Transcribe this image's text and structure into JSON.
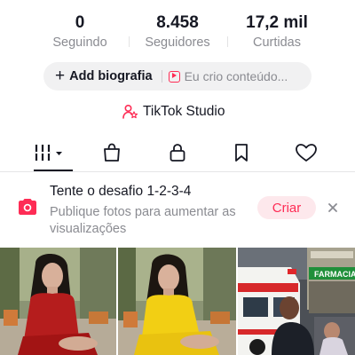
{
  "profile": {
    "stats": [
      {
        "value": "0",
        "label": "Seguindo"
      },
      {
        "value": "8.458",
        "label": "Seguidores"
      },
      {
        "value": "17,2 mil",
        "label": "Curtidas"
      }
    ],
    "add_bio_label": "Add biografia",
    "creator_label": "Eu crio conteúdo...",
    "studio_label": "TikTok Studio"
  },
  "tabs": [
    {
      "name": "videos",
      "icon": "grid-icon",
      "active": true
    },
    {
      "name": "shop",
      "icon": "bag-icon",
      "active": false
    },
    {
      "name": "private",
      "icon": "lock-icon",
      "active": false
    },
    {
      "name": "favorites",
      "icon": "bookmark-icon",
      "active": false
    },
    {
      "name": "liked",
      "icon": "heart-icon",
      "active": false
    }
  ],
  "banner": {
    "title": "Tente o desafio 1-2-3-4",
    "description": "Publique fotos para aumentar as visualizações",
    "cta": "Criar"
  },
  "grid": {
    "items": [
      {
        "type": "photo",
        "subject": "woman-red-dress"
      },
      {
        "type": "photo",
        "subject": "woman-yellow-dress"
      },
      {
        "type": "photo",
        "subject": "ambulance-street-scene",
        "sign_text": "FARMACIA"
      }
    ]
  },
  "colors": {
    "accent": "#fe2c55",
    "text_primary": "#161823",
    "text_secondary": "#8a8b91",
    "pill_bg": "#f1f1f2",
    "cta_bg": "#fde8ec"
  }
}
